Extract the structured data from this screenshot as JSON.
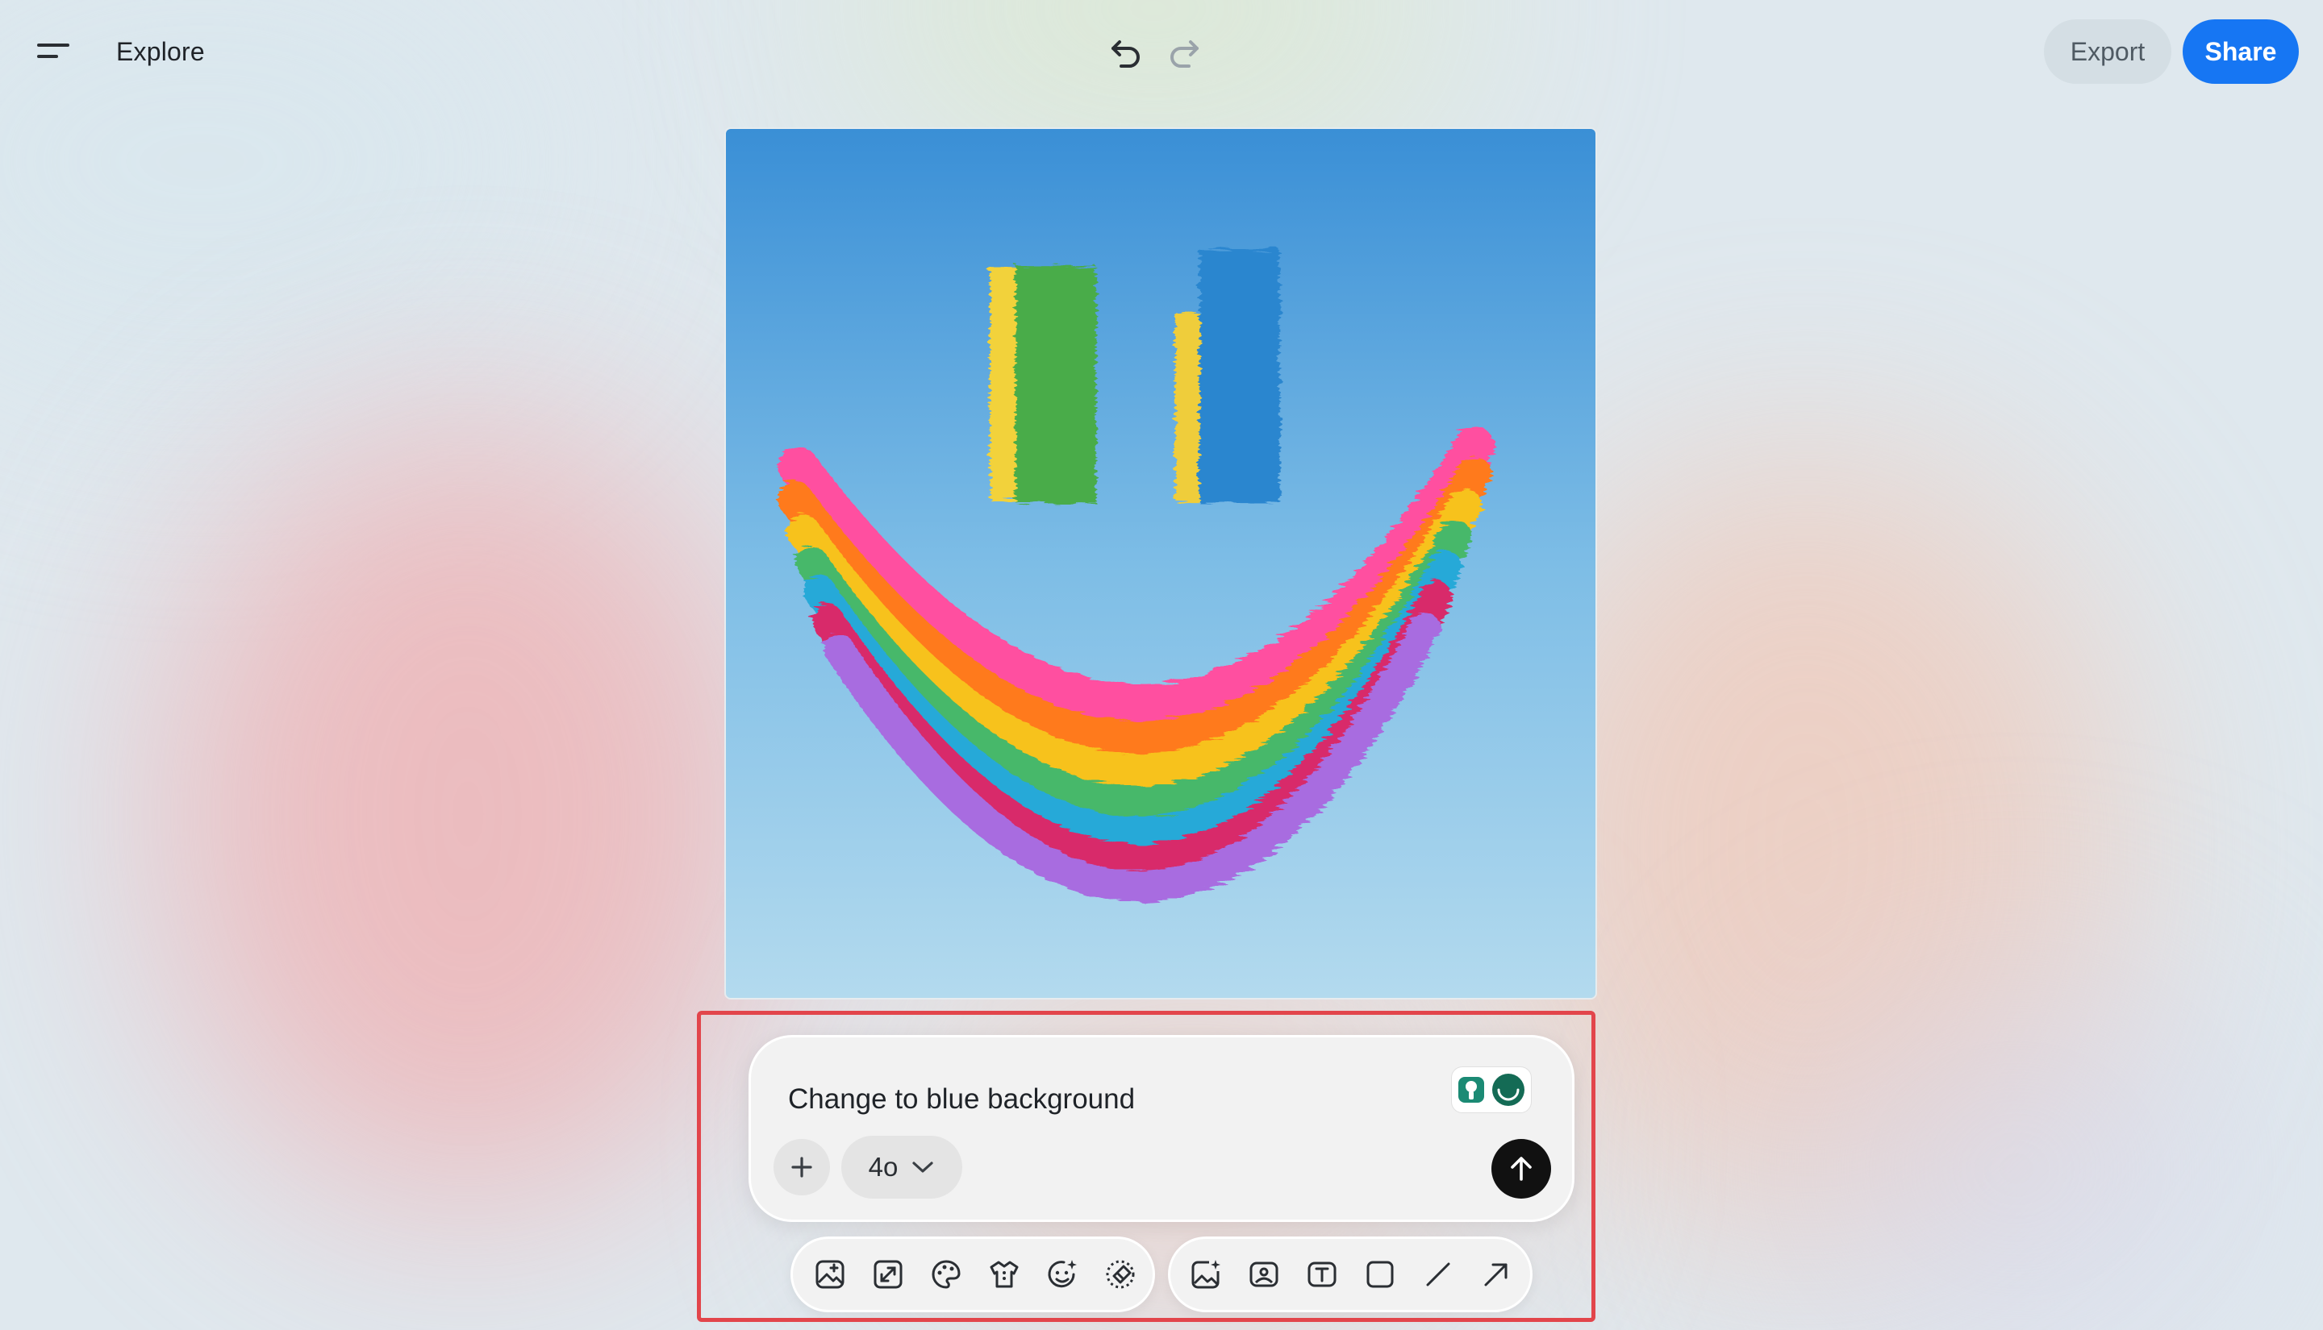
{
  "header": {
    "title": "Explore",
    "export_label": "Export",
    "share_label": "Share",
    "menu_icon": "menu-icon",
    "undo_icon": "undo-icon",
    "redo_icon": "redo-icon"
  },
  "canvas": {
    "image_alt": "painted rainbow smiley face on blue sky",
    "image_icon": "rainbow-smiley-image"
  },
  "prompt": {
    "value": "Change to blue background",
    "add_icon": "plus-icon",
    "model_label": "4o",
    "model_icon": "chevron-down-icon",
    "send_icon": "arrow-up-icon",
    "assist_icon": "assistant-avatars-icon"
  },
  "toolbar": {
    "left_tools": [
      "image-enhance-icon",
      "expand-icon",
      "palette-icon",
      "outfit-icon",
      "face-retouch-icon",
      "eraser-icon"
    ],
    "right_tools": [
      "add-image-icon",
      "image-edit-icon",
      "text-tool-icon",
      "rectangle-icon",
      "line-icon",
      "arrow-icon"
    ]
  },
  "colors": {
    "accent": "#1676f3",
    "highlight": "#e2454b",
    "send": "#111111"
  }
}
